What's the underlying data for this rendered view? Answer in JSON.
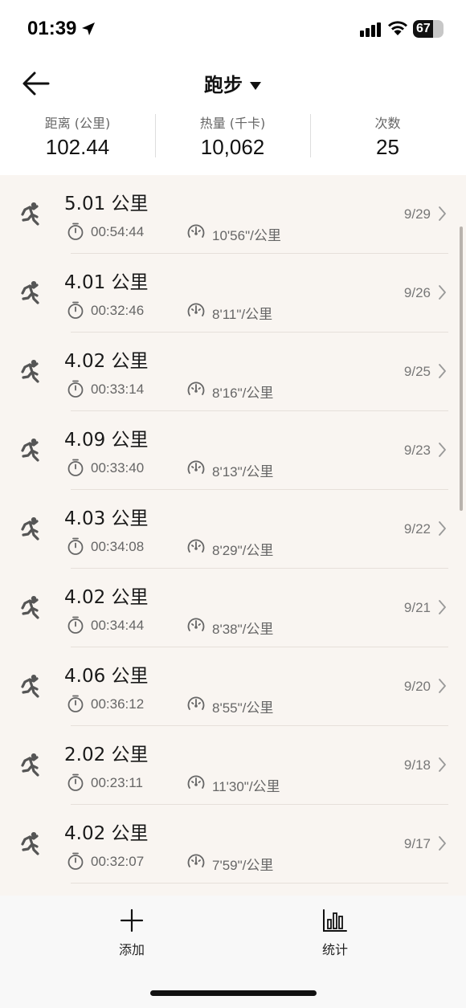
{
  "status": {
    "time": "01:39",
    "battery": "67",
    "battery_level": 0.67
  },
  "nav": {
    "back_icon": "arrow-left-icon",
    "title": "跑步",
    "title_dropdown_icon": "caret-down-icon"
  },
  "summary": {
    "distance_label": "距离 (公里)",
    "distance_value": "102.44",
    "calories_label": "热量 (千卡)",
    "calories_value": "10,062",
    "count_label": "次数",
    "count_value": "25"
  },
  "runs": [
    {
      "distance": "5.01 公里",
      "duration": "00:54:44",
      "pace": "10'56\"/公里",
      "date": "9/29"
    },
    {
      "distance": "4.01 公里",
      "duration": "00:32:46",
      "pace": "8'11\"/公里",
      "date": "9/26"
    },
    {
      "distance": "4.02 公里",
      "duration": "00:33:14",
      "pace": "8'16\"/公里",
      "date": "9/25"
    },
    {
      "distance": "4.09 公里",
      "duration": "00:33:40",
      "pace": "8'13\"/公里",
      "date": "9/23"
    },
    {
      "distance": "4.03 公里",
      "duration": "00:34:08",
      "pace": "8'29\"/公里",
      "date": "9/22"
    },
    {
      "distance": "4.02 公里",
      "duration": "00:34:44",
      "pace": "8'38\"/公里",
      "date": "9/21"
    },
    {
      "distance": "4.06 公里",
      "duration": "00:36:12",
      "pace": "8'55\"/公里",
      "date": "9/20"
    },
    {
      "distance": "2.02 公里",
      "duration": "00:23:11",
      "pace": "11'30\"/公里",
      "date": "9/18"
    },
    {
      "distance": "4.02 公里",
      "duration": "00:32:07",
      "pace": "7'59\"/公里",
      "date": "9/17"
    }
  ],
  "tabs": {
    "add_label": "添加",
    "add_icon": "plus-icon",
    "stats_label": "统计",
    "stats_icon": "bar-chart-icon"
  },
  "colors": {
    "list_background": "#f9f5f1",
    "icon_gray": "#666666"
  }
}
